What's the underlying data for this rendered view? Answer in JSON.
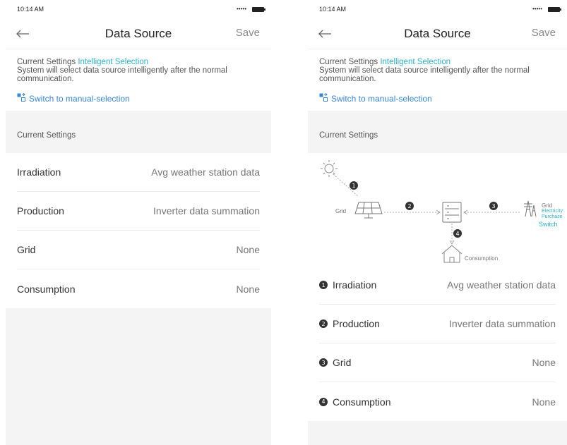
{
  "status_bar": {
    "time": "10:14 AM",
    "signal": "•••••"
  },
  "nav": {
    "title": "Data Source",
    "save_label": "Save"
  },
  "info": {
    "current_prefix": "Current Settings",
    "current_mode": "Intelligent Selection",
    "description": "System will select data source intelligently after the normal communication.",
    "switch_link": "Switch to manual-selection"
  },
  "section": {
    "title": "Current Settings"
  },
  "settings": [
    {
      "label": "Irradiation",
      "value": "Avg weather station data"
    },
    {
      "label": "Production",
      "value": "Inverter data summation"
    },
    {
      "label": "Grid",
      "value": "None"
    },
    {
      "label": "Consumption",
      "value": "None"
    }
  ],
  "diagram": {
    "grid_left_label": "Grid",
    "grid_right_label": "Grid",
    "electricity_label": "Electricity",
    "purchase_label": "Purchase",
    "switch_label": "Switch",
    "consumption_label": "Consumption",
    "badges": [
      "1",
      "2",
      "3",
      "4"
    ]
  },
  "colors": {
    "accent": "#2fb1c9",
    "link": "#3a86d4",
    "background": "#f4f4f4"
  }
}
